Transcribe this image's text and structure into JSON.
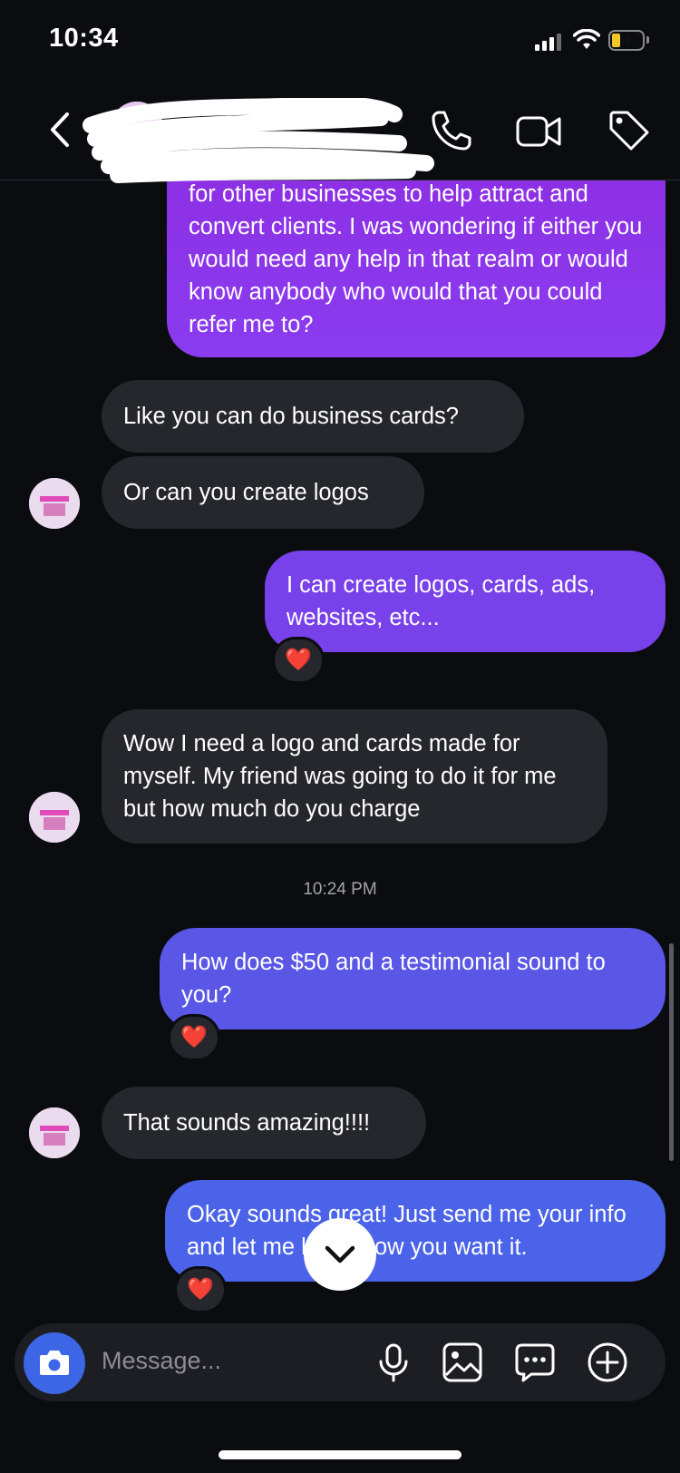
{
  "status_bar": {
    "time": "10:34",
    "battery": "4"
  },
  "header": {
    "contact_name": "...sell...",
    "subtitle": "pa"
  },
  "messages": [
    {
      "text": "for other businesses to help attract and convert clients. I was wondering if either you would need any help in that realm or would know anybody who would that you could refer me to?"
    },
    {
      "text": "Like you can do business cards?"
    },
    {
      "text": "Or can you create logos"
    },
    {
      "text": "I can create logos, cards, ads, websites, etc..."
    },
    {
      "text": "Wow I need a logo and cards made for myself. My friend was going to do it for me but how much do you charge"
    },
    {
      "text": "How does $50 and a testimonial sound to you?"
    },
    {
      "text": "That sounds amazing!!!!"
    },
    {
      "text": "Okay sounds great! Just send me your info and let me know how you want it."
    }
  ],
  "reaction": "❤️",
  "timestamp": "10:24 PM",
  "composer": {
    "placeholder": "Message..."
  },
  "colors": {
    "background": "#0b0c10",
    "incoming_bubble": "#26272c",
    "outgoing_purple": "#8a38ec",
    "outgoing_violet": "#6f49ea",
    "outgoing_blue": "#5757e6",
    "outgoing_royal": "#4a63e8",
    "camera_button": "#3d66e6"
  },
  "icons": [
    "back-arrow-icon",
    "phone-icon",
    "video-call-icon",
    "tag-icon",
    "camera-icon",
    "microphone-icon",
    "gallery-icon",
    "sticker-icon",
    "plus-icon",
    "chevron-down-icon"
  ]
}
